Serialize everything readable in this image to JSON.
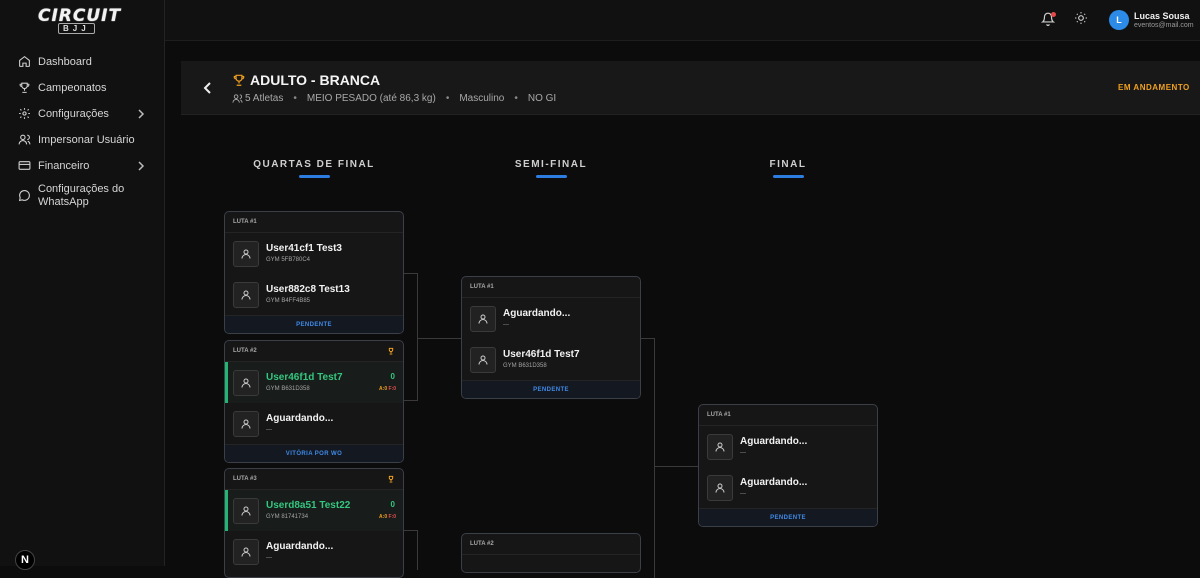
{
  "brand": {
    "line1": "CIRCUIT",
    "line2": "BJJ"
  },
  "sidebar": {
    "items": [
      {
        "label": "Dashboard",
        "icon": "home-icon"
      },
      {
        "label": "Campeonatos",
        "icon": "trophy-icon"
      },
      {
        "label": "Configurações",
        "icon": "gear-icon",
        "has_chevron": true
      },
      {
        "label": "Impersonar Usuário",
        "icon": "user-icon"
      },
      {
        "label": "Financeiro",
        "icon": "card-icon",
        "has_chevron": true
      },
      {
        "label": "Configurações do WhatsApp",
        "icon": "chat-icon"
      }
    ],
    "badge": "N"
  },
  "topbar": {
    "user_initial": "L",
    "user_name": "Lucas Sousa",
    "user_email": "eventos@mail.com"
  },
  "header": {
    "title": "ADULTO - BRANCA",
    "athletes": "5 Atletas",
    "weight": "MEIO PESADO (até 86,3 kg)",
    "gender": "Masculino",
    "modality": "NO GI",
    "status": "EM ANDAMENTO"
  },
  "rounds": {
    "quarter": "QUARTAS DE FINAL",
    "semi": "SEMI-FINAL",
    "final": "FINAL"
  },
  "quarter_matches": [
    {
      "label": "LUTA #1",
      "footer": "PENDENTE",
      "a": {
        "name": "User41cf1 Test3",
        "gym": "GYM 5FB780C4"
      },
      "b": {
        "name": "User882c8 Test13",
        "gym": "GYM B4FF4B85"
      }
    },
    {
      "label": "LUTA #2",
      "footer": "VITÓRIA POR WO",
      "a": {
        "name": "User46f1d Test7",
        "gym": "GYM B631D358",
        "score": "0",
        "adv": "A:0",
        "fouls": "F:0"
      },
      "b": {
        "name": "Aguardando...",
        "gym": "---"
      }
    },
    {
      "label": "LUTA #3",
      "a": {
        "name": "Userd8a51 Test22",
        "gym": "GYM 81741734",
        "score": "0",
        "adv": "A:0",
        "fouls": "F:0"
      },
      "b": {
        "name": "Aguardando...",
        "gym": "---"
      }
    }
  ],
  "semi_matches": [
    {
      "label": "LUTA #1",
      "footer": "PENDENTE",
      "a": {
        "name": "Aguardando...",
        "gym": "---"
      },
      "b": {
        "name": "User46f1d Test7",
        "gym": "GYM B631D358"
      }
    },
    {
      "label": "LUTA #2"
    }
  ],
  "final_match": {
    "label": "LUTA #1",
    "footer": "PENDENTE",
    "a": {
      "name": "Aguardando...",
      "gym": "---"
    },
    "b": {
      "name": "Aguardando...",
      "gym": "---"
    }
  },
  "colors": {
    "accent": "#2d7de0",
    "winner": "#34c77f",
    "status": "#f0a020"
  }
}
